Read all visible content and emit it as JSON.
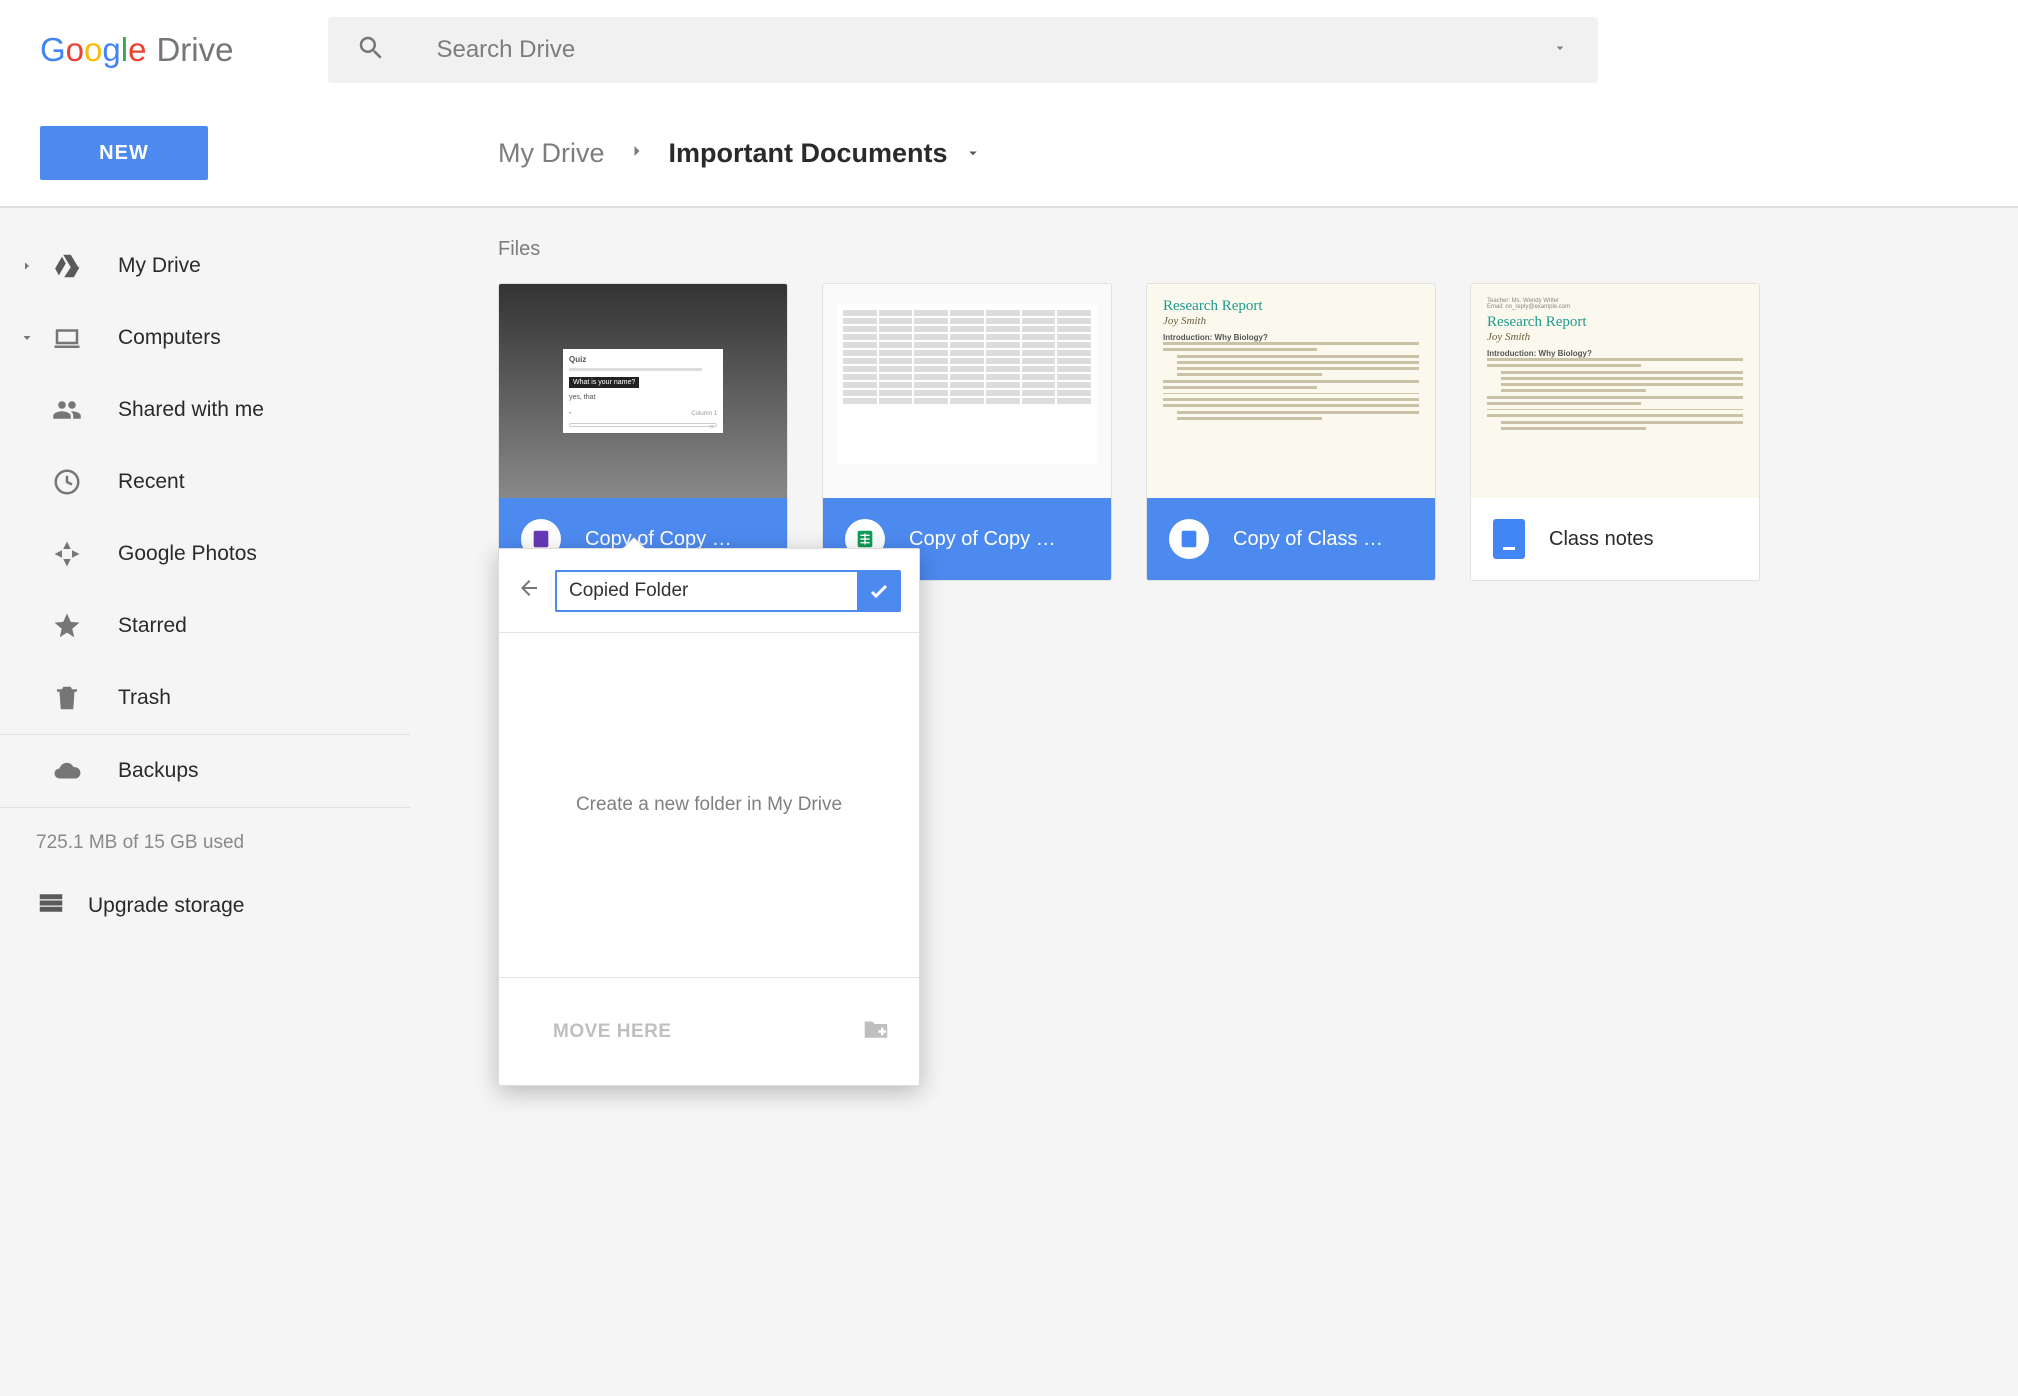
{
  "app": {
    "logo_word1": "Google",
    "logo_word2": "Drive"
  },
  "search": {
    "placeholder": "Search Drive"
  },
  "new_button": {
    "label": "NEW"
  },
  "sidebar": {
    "items": [
      {
        "label": "My Drive"
      },
      {
        "label": "Computers"
      },
      {
        "label": "Shared with me"
      },
      {
        "label": "Recent"
      },
      {
        "label": "Google Photos"
      },
      {
        "label": "Starred"
      },
      {
        "label": "Trash"
      },
      {
        "label": "Backups"
      }
    ],
    "storage_usage": "725.1 MB of 15 GB used",
    "upgrade_label": "Upgrade storage"
  },
  "breadcrumb": {
    "root": "My Drive",
    "current": "Important Documents"
  },
  "files_heading": "Files",
  "files": [
    {
      "name": "Copy of Copy …",
      "selected": true,
      "app": "forms",
      "thumb": "quiz"
    },
    {
      "name": "Copy of Copy …",
      "selected": true,
      "app": "sheets",
      "thumb": "sheet"
    },
    {
      "name": "Copy of Class …",
      "selected": true,
      "app": "docs",
      "thumb": "report"
    },
    {
      "name": "Class notes",
      "selected": false,
      "app": "docs",
      "thumb": "report"
    }
  ],
  "thumb_report": {
    "title": "Research Report",
    "author": "Joy Smith",
    "section": "Introduction: Why Biology?"
  },
  "thumb_quiz": {
    "heading": "Quiz",
    "question_bar": "What is your name?",
    "answer": "yes, that"
  },
  "popover": {
    "input_value": "Copied Folder",
    "body_text": "Create a new folder in My Drive",
    "action_label": "MOVE HERE"
  }
}
